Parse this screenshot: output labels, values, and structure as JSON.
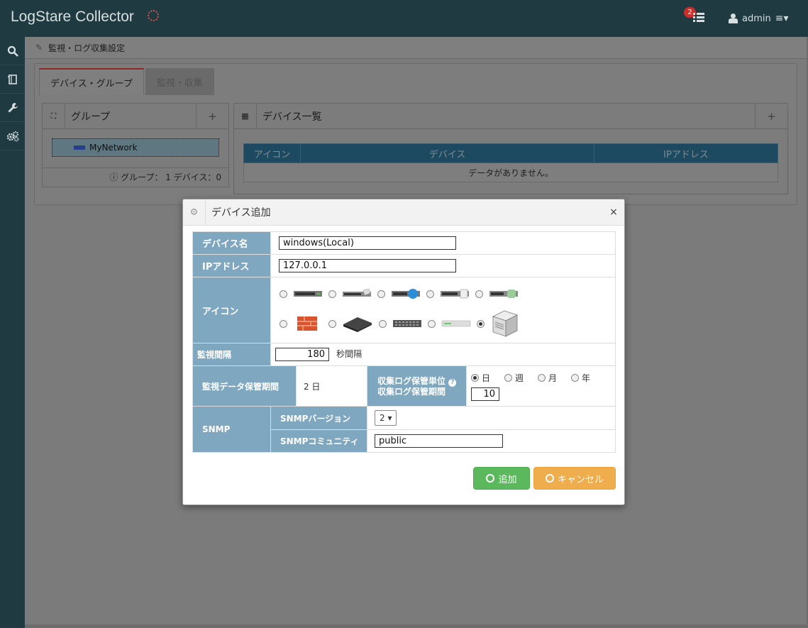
{
  "app": {
    "title": "LogStare Collector"
  },
  "header": {
    "notification_count": "2",
    "user": "admin"
  },
  "sidebar": {
    "items": [
      "search-icon",
      "book-icon",
      "wrench-icon",
      "gears-icon"
    ]
  },
  "breadcrumb": "監視・ログ収集設定",
  "tabs": [
    "デバイス・グループ",
    "監視・収集"
  ],
  "group_panel": {
    "title": "グループ",
    "node": "MyNetwork",
    "footer": "グループ： 1  デバイス：0"
  },
  "device_panel": {
    "title": "デバイス一覧",
    "columns": [
      "アイコン",
      "デバイス",
      "IPアドレス"
    ],
    "empty_text": "データがありません。"
  },
  "modal": {
    "title": "デバイス追加",
    "close": "×",
    "device_name_label": "デバイス名",
    "device_name_value": "windows(Local)",
    "ip_label": "IPアドレス",
    "ip_value": "127.0.0.1",
    "icon_label": "アイコン",
    "selected_icon_index": 9,
    "interval_label": "監視間隔",
    "interval_value": "180",
    "interval_unit": "秒間隔",
    "retention_label": "監視データ保管期間",
    "retention_value": "2 日",
    "log_unit_label": "収集ログ保管単位",
    "log_period_label": "収集ログ保管期間",
    "log_units": [
      "日",
      "週",
      "月",
      "年"
    ],
    "log_unit_selected": "日",
    "log_period_value": "10",
    "snmp_label": "SNMP",
    "snmp_version_label": "SNMPバージョン",
    "snmp_version_value": "2",
    "snmp_community_label": "SNMPコミュニティ",
    "snmp_community_value": "public",
    "add_button": "追加",
    "cancel_button": "キャンセル"
  }
}
